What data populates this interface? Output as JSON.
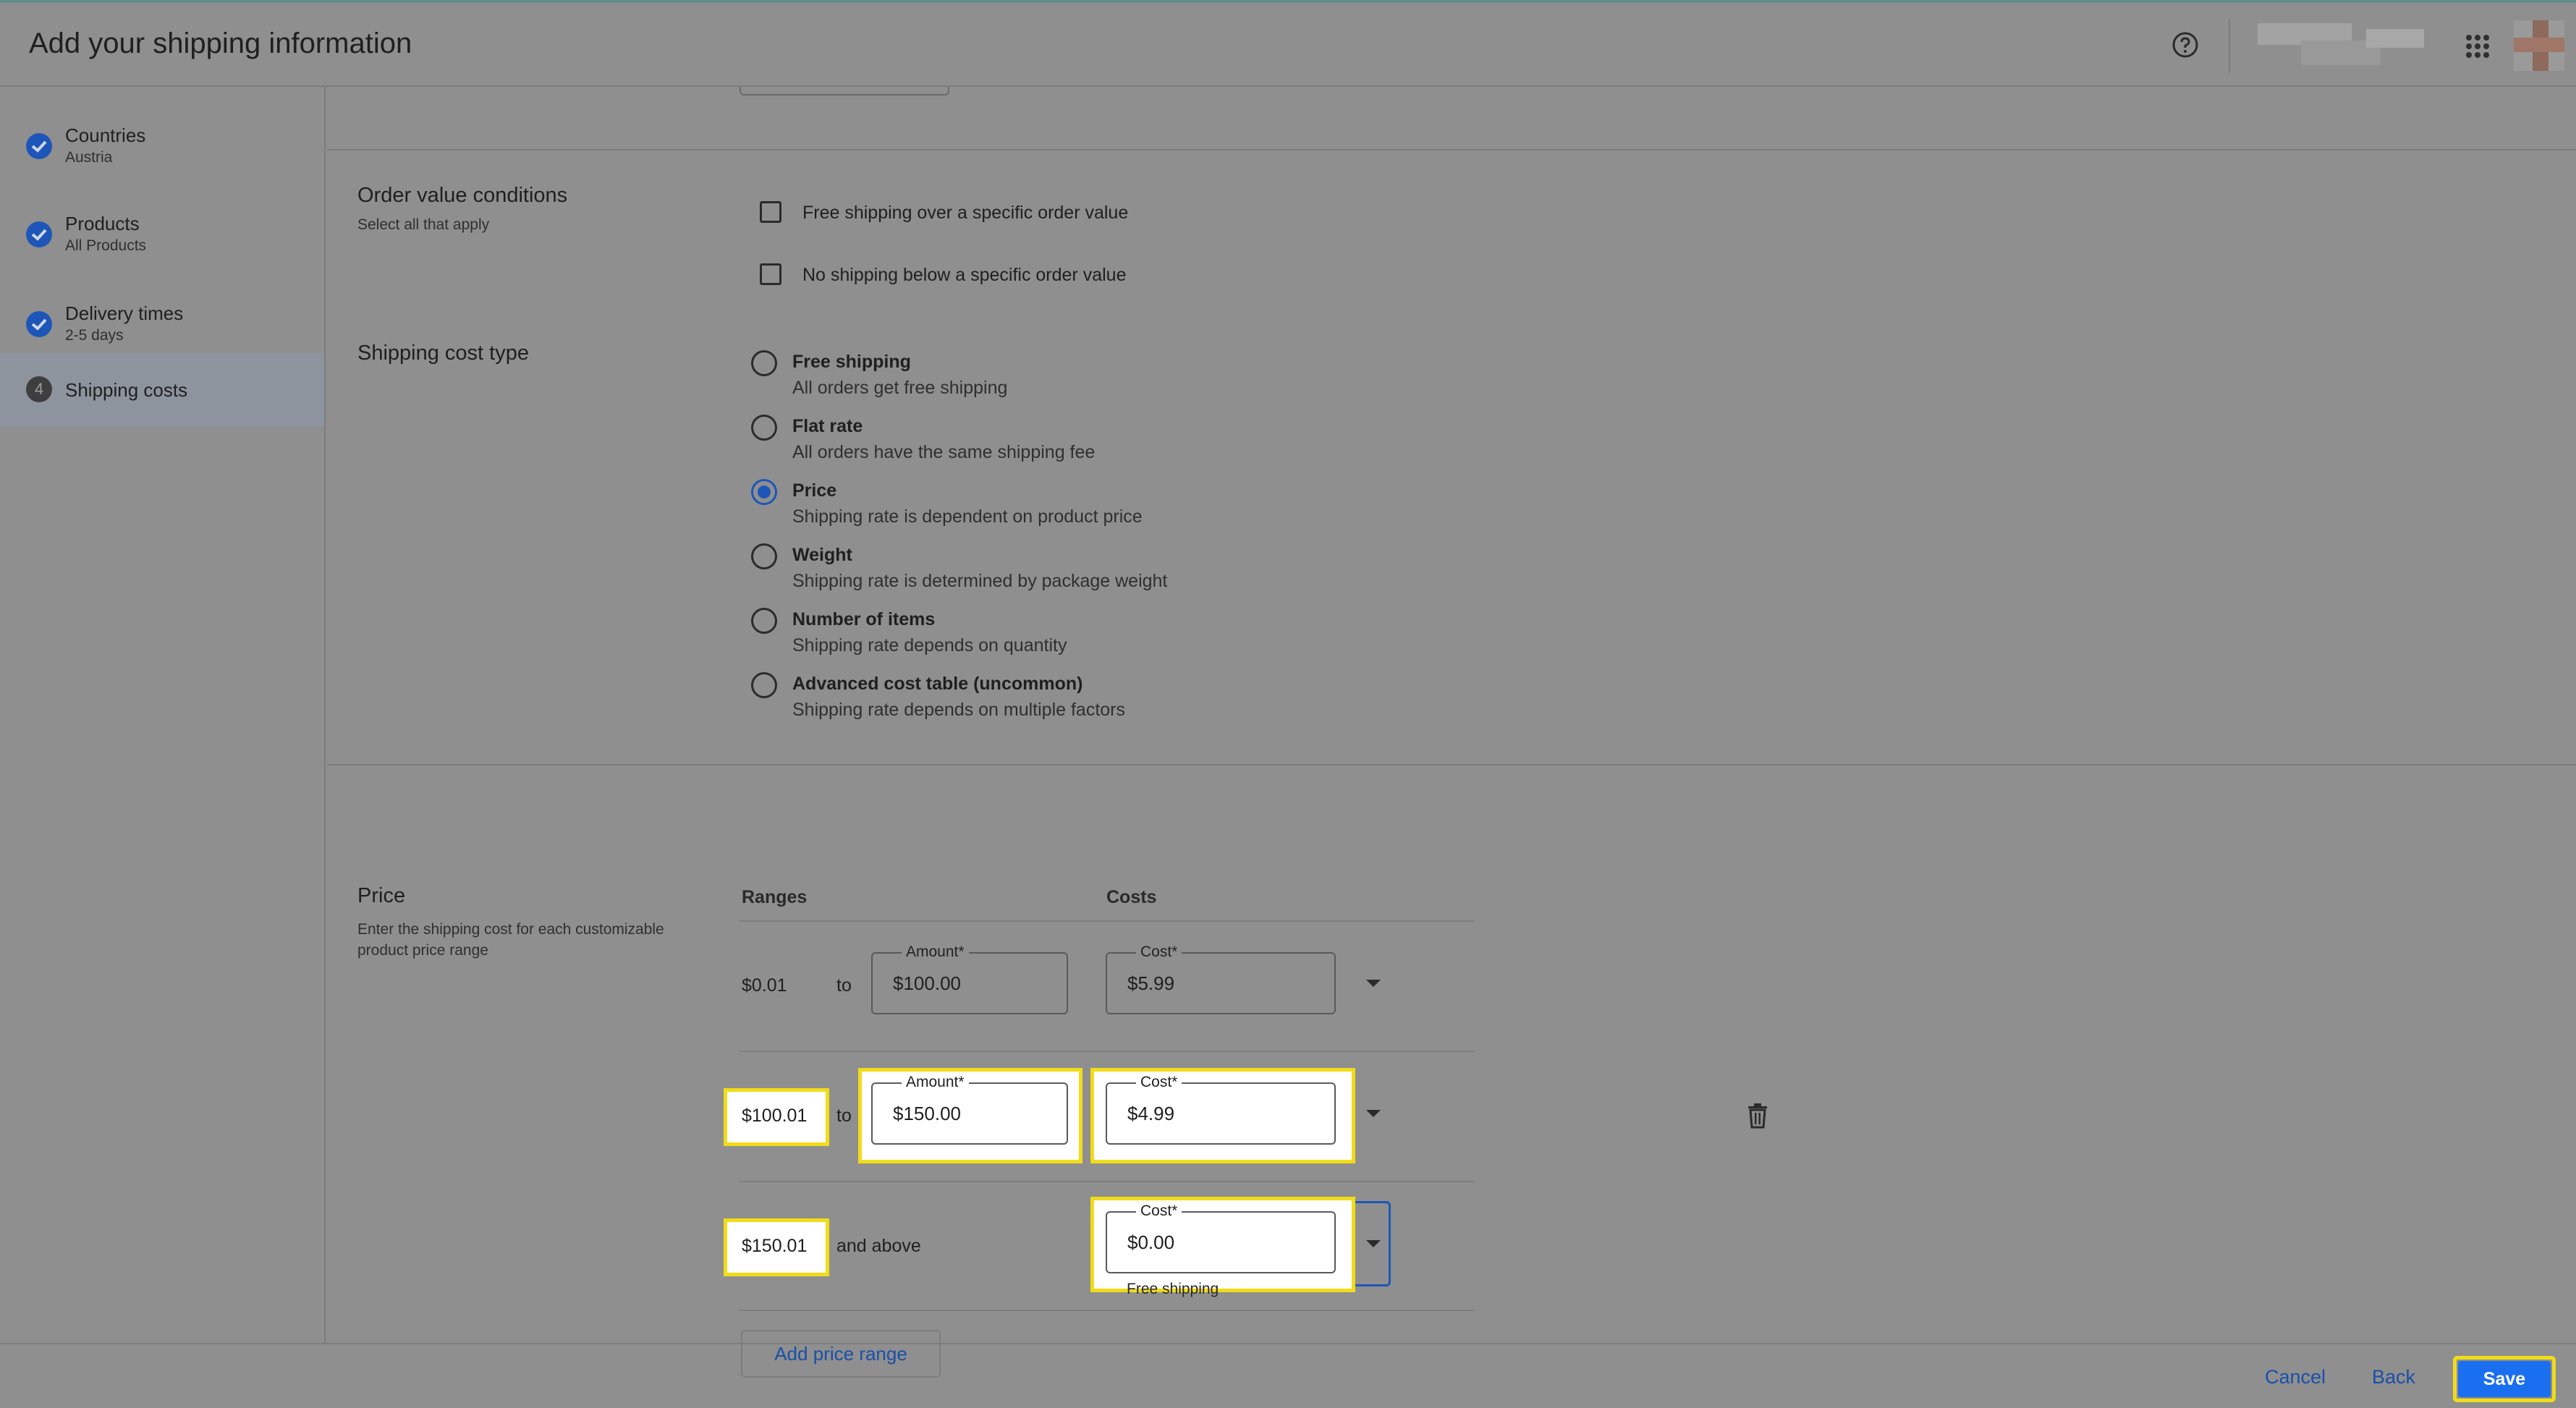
{
  "header": {
    "title": "Add your shipping information"
  },
  "sidebar": {
    "steps": [
      {
        "label": "Countries",
        "sub": "Austria",
        "state": "done"
      },
      {
        "label": "Products",
        "sub": "All Products",
        "state": "done"
      },
      {
        "label": "Delivery times",
        "sub": "2-5 days",
        "state": "done"
      },
      {
        "label": "Shipping costs",
        "sub": "",
        "state": "active",
        "number": "4"
      }
    ]
  },
  "order_value": {
    "title": "Order value conditions",
    "subtitle": "Select all that apply",
    "options": [
      {
        "label": "Free shipping over a specific order value",
        "checked": false
      },
      {
        "label": "No shipping below a specific order value",
        "checked": false
      }
    ]
  },
  "cost_type": {
    "title": "Shipping cost type",
    "options": [
      {
        "label": "Free shipping",
        "sub": "All orders get free shipping",
        "selected": false
      },
      {
        "label": "Flat rate",
        "sub": "All orders have the same shipping fee",
        "selected": false
      },
      {
        "label": "Price",
        "sub": "Shipping rate is dependent on product price",
        "selected": true
      },
      {
        "label": "Weight",
        "sub": "Shipping rate is determined by package weight",
        "selected": false
      },
      {
        "label": "Number of items",
        "sub": "Shipping rate depends on quantity",
        "selected": false
      },
      {
        "label": "Advanced cost table (uncommon)",
        "sub": "Shipping rate depends on multiple factors",
        "selected": false
      }
    ]
  },
  "price": {
    "title": "Price",
    "subtitle_line1": "Enter the shipping cost for each customizable",
    "subtitle_line2": "product price range",
    "ranges_header": "Ranges",
    "costs_header": "Costs",
    "amount_label": "Amount*",
    "cost_label": "Cost*",
    "currency": "$",
    "to_text": "to",
    "and_above_text": "and above",
    "rows": [
      {
        "from": "$0.01",
        "amount": "100.00",
        "cost": "5.99"
      },
      {
        "from": "$100.01",
        "amount": "150.00",
        "cost": "4.99"
      },
      {
        "from": "$150.01",
        "cost": "0.00",
        "helper": "Free shipping"
      }
    ],
    "add_button": "Add price range"
  },
  "footer": {
    "cancel": "Cancel",
    "back": "Back",
    "save": "Save"
  },
  "colors": {
    "accent": "#1a6ef0",
    "highlight": "#f1dc18"
  }
}
